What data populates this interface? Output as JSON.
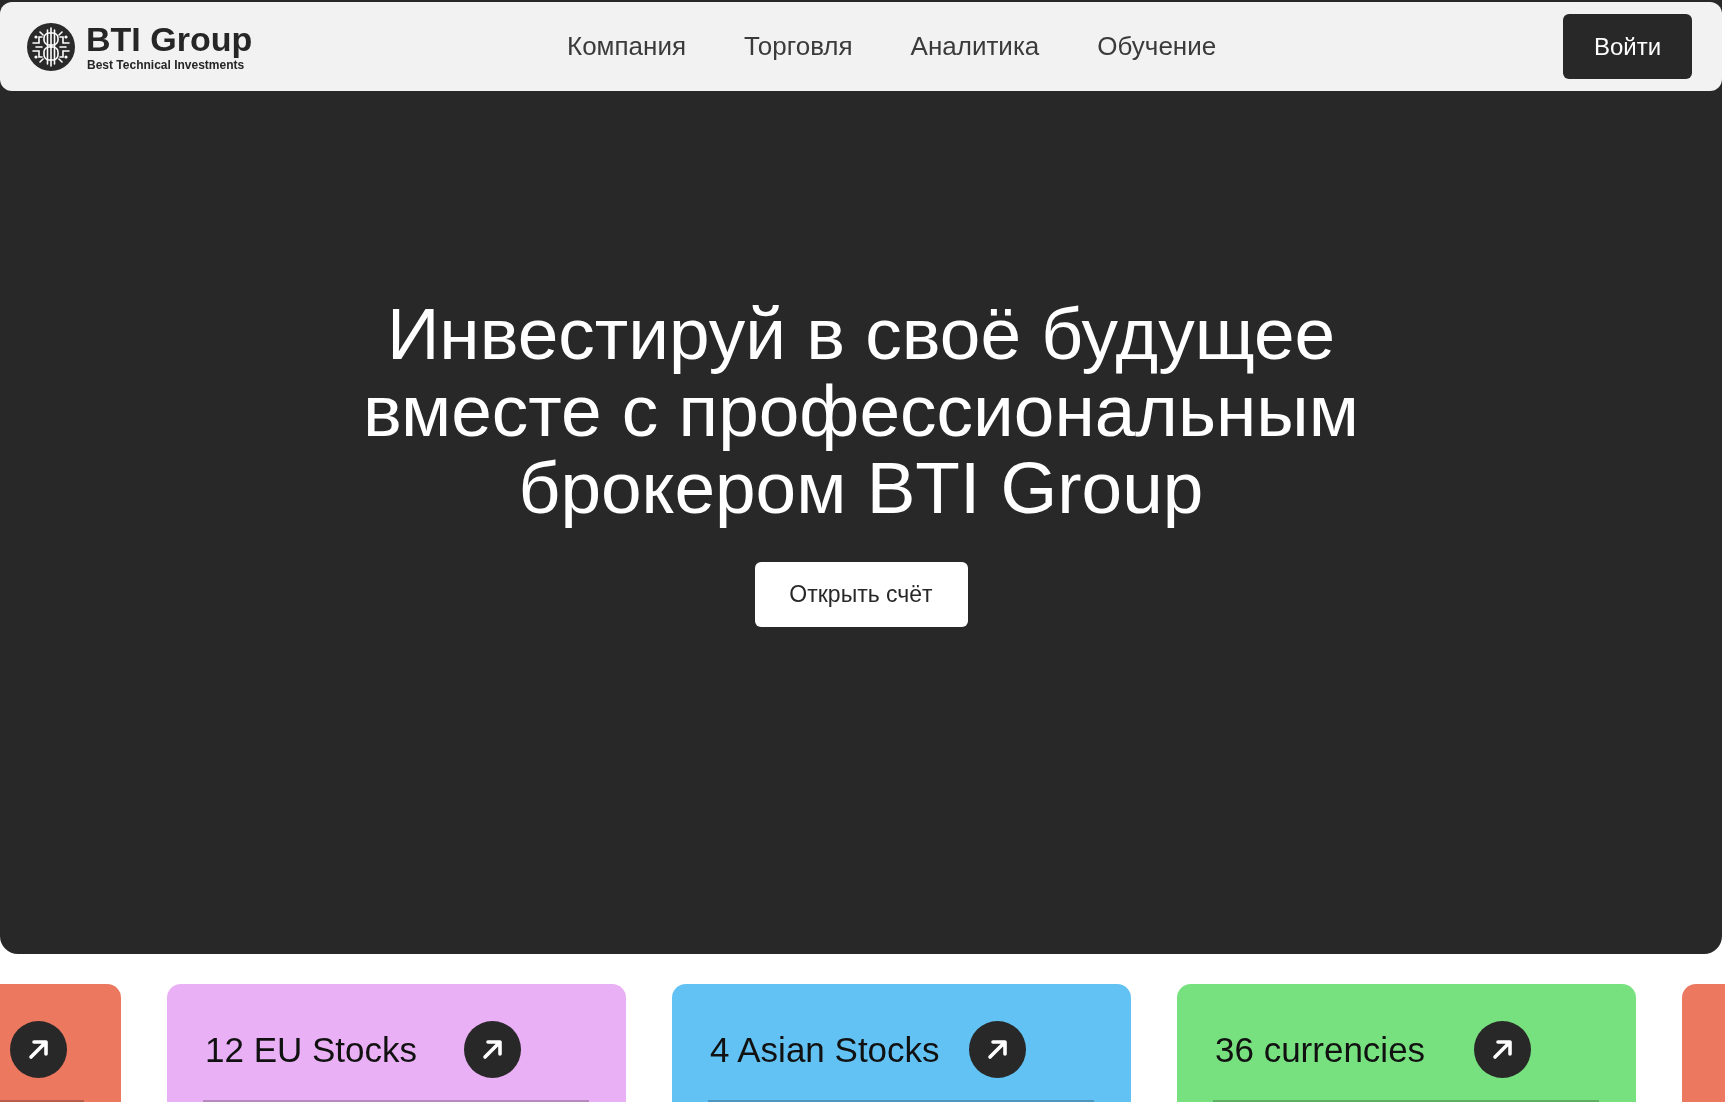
{
  "header": {
    "logo": {
      "name": "BTI Group",
      "tagline": "Best Technical Investments"
    },
    "nav": [
      "Компания",
      "Торговля",
      "Аналитика",
      "Обучение"
    ],
    "login_button": "Войти"
  },
  "hero": {
    "heading": "Инвестируй в своё будущее вместе с профессиональным брокером BTI Group",
    "cta_button": "Открыть счёт"
  },
  "cards": [
    {
      "kind": "arrow_only",
      "color": "#ec7860"
    },
    {
      "kind": "full",
      "label": "12 EU Stocks",
      "color": "#eab0f5"
    },
    {
      "kind": "full",
      "label": "4 Asian Stocks",
      "color": "#62c2f3"
    },
    {
      "kind": "full",
      "label": "36 currencies",
      "color": "#78e17f"
    },
    {
      "kind": "edge",
      "color": "#ec7860"
    }
  ]
}
